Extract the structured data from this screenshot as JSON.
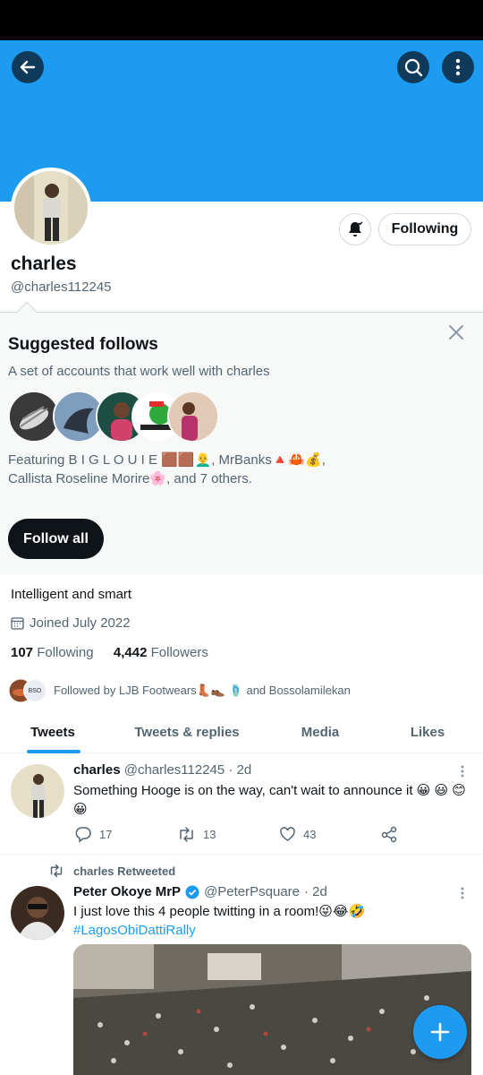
{
  "profile": {
    "display_name": "charles",
    "handle": "@charles112245",
    "following_button": "Following",
    "bio": "Intelligent and smart",
    "joined": "Joined July 2022",
    "following_count": "107",
    "following_label": "Following",
    "followers_count": "4,442",
    "followers_label": "Followers",
    "followed_by": "Followed by LJB Footwears👢👞 🩴 and Bossolamilekan"
  },
  "suggested": {
    "title": "Suggested follows",
    "subtitle": "A set of accounts that work well with charles",
    "featuring_line1": "Featuring B I G L O U I E 🟫🟫👨‍🦲, MrBanks🔺🦀💰,",
    "featuring_line2": "Callista Roseline Morire🌸, and 7 others.",
    "follow_all": "Follow all"
  },
  "tabs": [
    {
      "label": "Tweets",
      "active": true
    },
    {
      "label": "Tweets & replies",
      "active": false
    },
    {
      "label": "Media",
      "active": false
    },
    {
      "label": "Likes",
      "active": false
    }
  ],
  "tweets": [
    {
      "name": "charles",
      "handle": "@charles112245",
      "time": "· 2d",
      "text": "Something Hooge is on the way, can't wait to announce it 😀 😃 😊 😀",
      "replies": "17",
      "retweets": "13",
      "likes": "43"
    },
    {
      "retweeted_by": "charles Retweeted",
      "name": "Peter Okoye MrP",
      "handle": "@PeterPsquare",
      "time": "· 2d",
      "text": "I just love this 4 people twitting in a room!😜😂🤣",
      "hashtag": "#LagosObiDattiRally"
    }
  ],
  "colors": {
    "accent": "#1d9bf0",
    "banner": "#1d9bf0",
    "text": "#0f1419",
    "muted": "#536471"
  }
}
